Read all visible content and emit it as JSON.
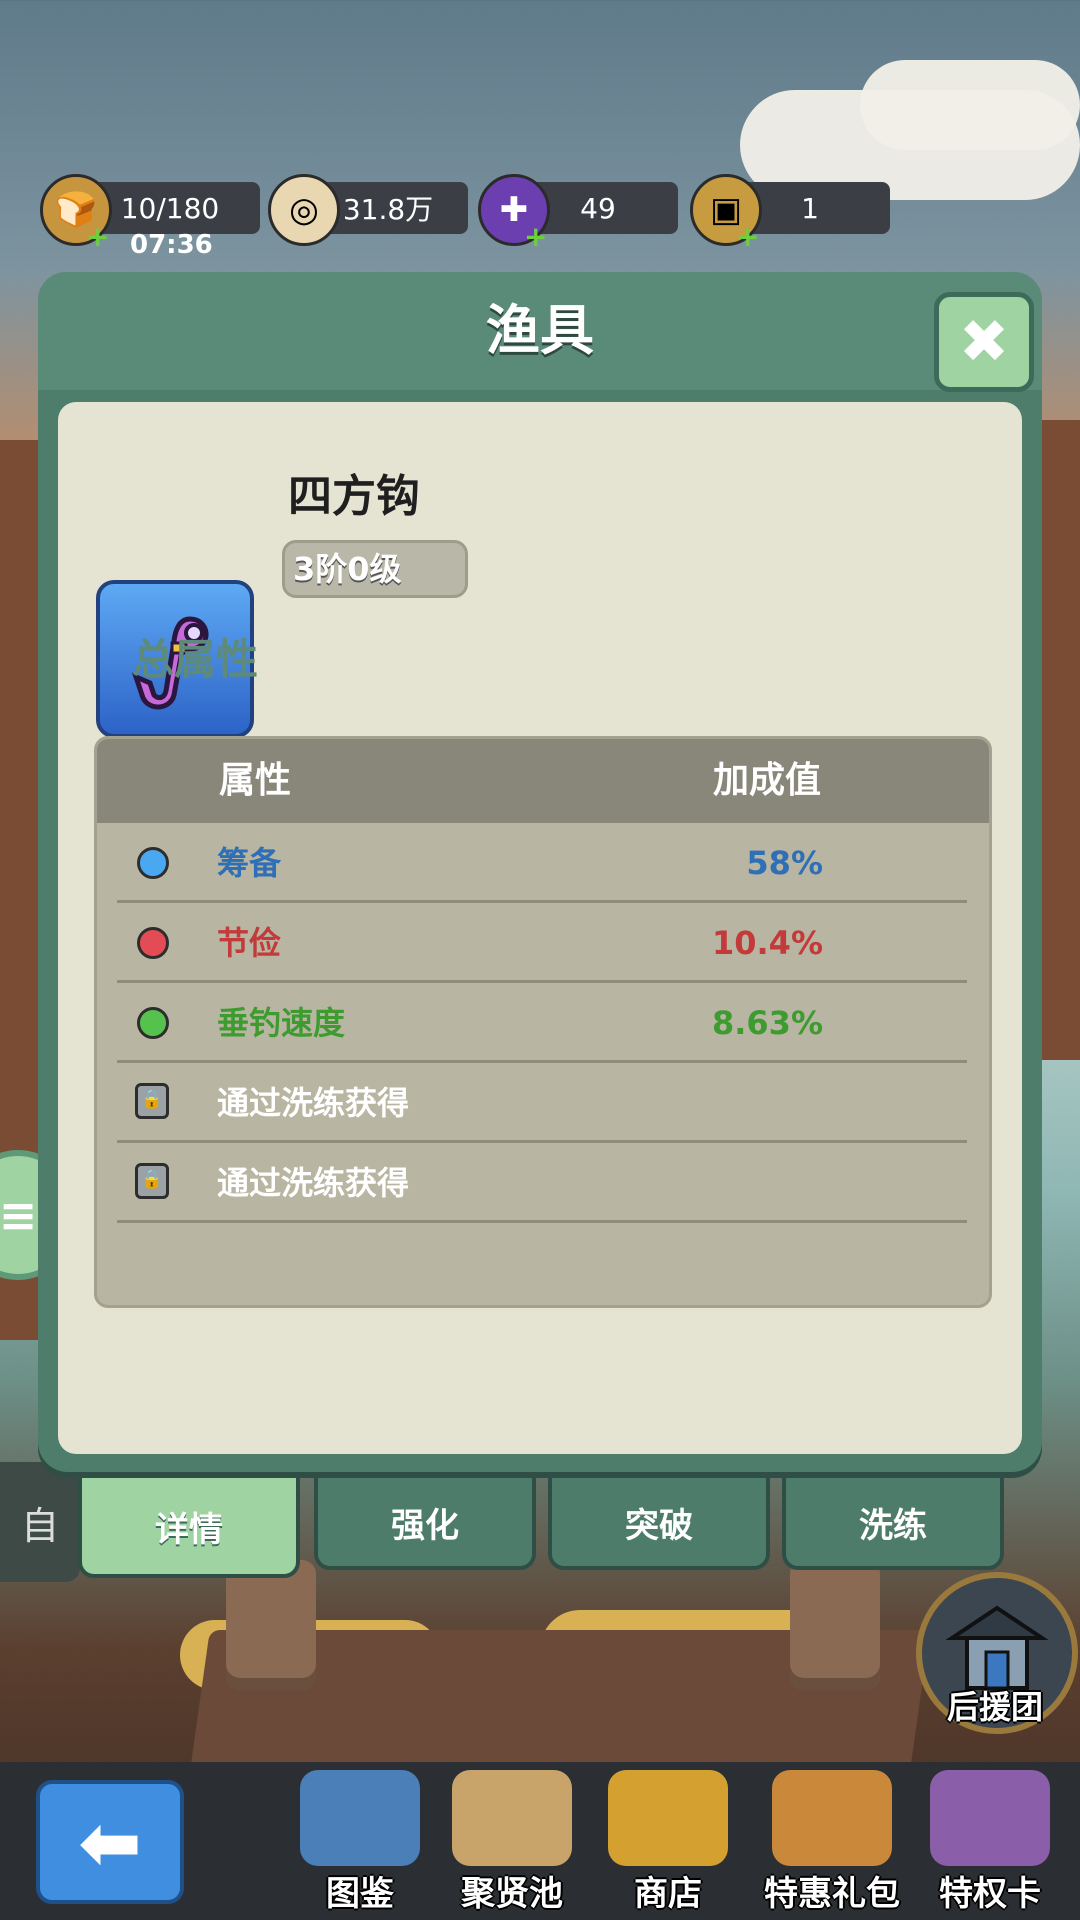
{
  "resources": [
    {
      "icon": "stamina-icon",
      "value": "10/180",
      "timer": "07:36",
      "has_plus": true
    },
    {
      "icon": "coin-icon",
      "value": "31.8万",
      "has_plus": false
    },
    {
      "icon": "gem-icon",
      "value": "49",
      "has_plus": true
    },
    {
      "icon": "treasure-icon",
      "value": "1",
      "has_plus": true
    }
  ],
  "panel": {
    "title": "渔具",
    "close_label": "✖",
    "item": {
      "name": "四方钩",
      "level": "3阶0级"
    },
    "section_title": "总属性",
    "table": {
      "headers": [
        "属性",
        "加成值"
      ],
      "rows": [
        {
          "type": "dot",
          "color": "#4aa8f0",
          "name": "筹备",
          "value": "58%",
          "text_color": "#2f6fb6",
          "value_color": "#2f6fb6"
        },
        {
          "type": "dot",
          "color": "#e34b55",
          "name": "节俭",
          "value": "10.4%",
          "text_color": "#c23a3a",
          "value_color": "#c23a3a"
        },
        {
          "type": "dot",
          "color": "#56c24e",
          "name": "垂钓速度",
          "value": "8.63%",
          "text_color": "#3d9b2f",
          "value_color": "#3d9b2f"
        },
        {
          "type": "lock",
          "name": "通过洗练获得",
          "value": "",
          "text_color": "#ffffff"
        },
        {
          "type": "lock",
          "name": "通过洗练获得",
          "value": "",
          "text_color": "#ffffff"
        }
      ]
    }
  },
  "tabs": [
    {
      "label": "详情",
      "active": true
    },
    {
      "label": "强化",
      "active": false
    },
    {
      "label": "突破",
      "active": false
    },
    {
      "label": "洗练",
      "active": false
    }
  ],
  "auto_tab_label": "自",
  "side_menu_icon": "menu-icon",
  "rescue_label": "后援团",
  "bottom_nav": [
    {
      "label": "图鉴",
      "icon": "book-icon",
      "color": "#4a7fb8"
    },
    {
      "label": "聚贤池",
      "icon": "map-icon",
      "color": "#c9a46a"
    },
    {
      "label": "商店",
      "icon": "shop-icon",
      "color": "#d4a030"
    },
    {
      "label": "特惠礼包",
      "icon": "giftpack-icon",
      "color": "#c9883a"
    },
    {
      "label": "特权卡",
      "icon": "vipcard-icon",
      "color": "#8a5ea8"
    }
  ]
}
